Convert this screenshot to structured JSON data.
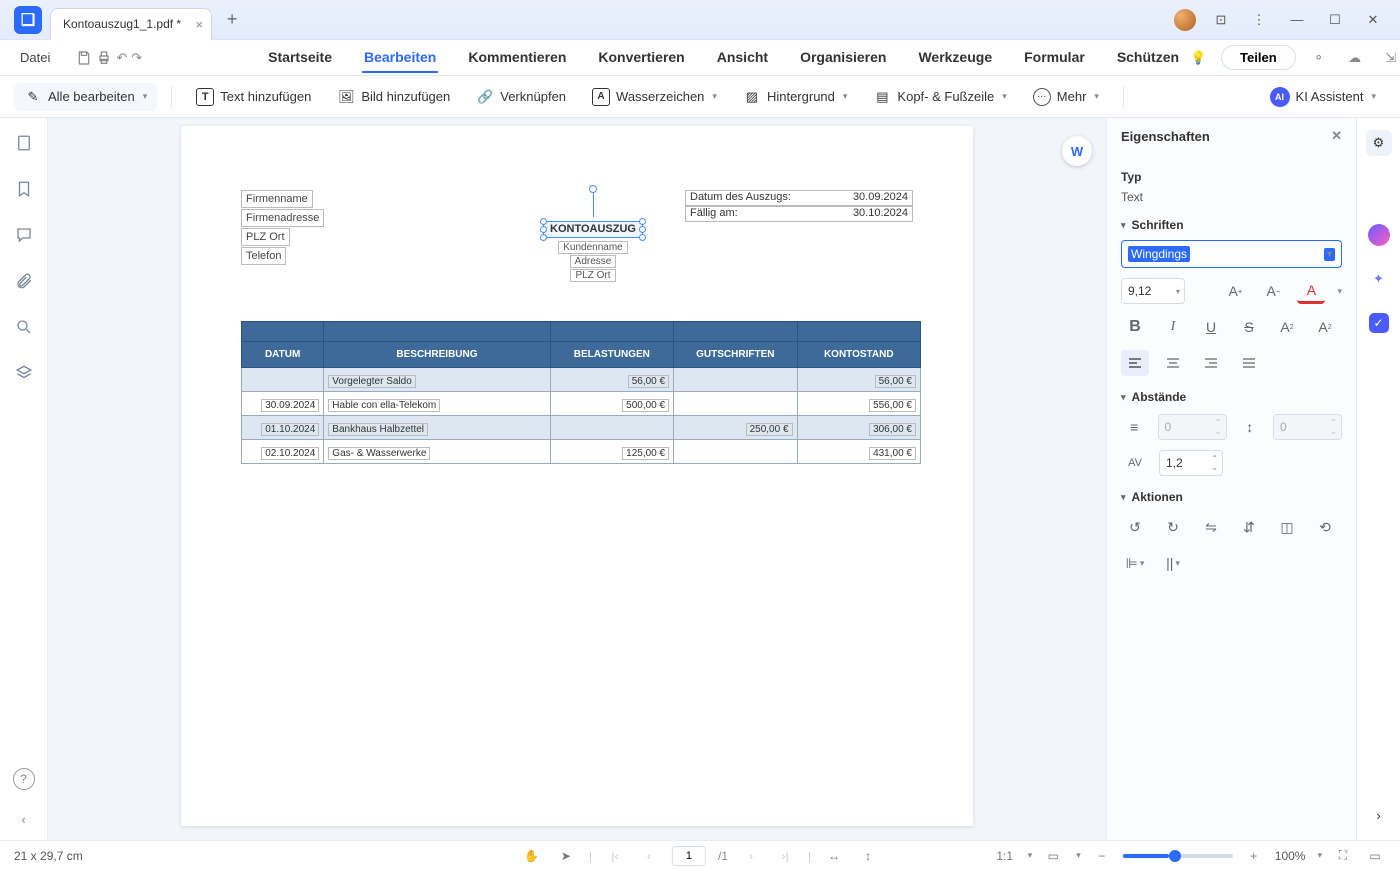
{
  "tab_title": "Kontoauszug1_1.pdf *",
  "menu": {
    "file": "Datei",
    "tabs": [
      "Startseite",
      "Bearbeiten",
      "Kommentieren",
      "Konvertieren",
      "Ansicht",
      "Organisieren",
      "Werkzeuge",
      "Formular",
      "Schützen"
    ],
    "active": "Bearbeiten",
    "teilen": "Teilen"
  },
  "toolbar": {
    "edit_all": "Alle bearbeiten",
    "add_text": "Text hinzufügen",
    "add_image": "Bild hinzufügen",
    "link": "Verknüpfen",
    "watermark": "Wasserzeichen",
    "background": "Hintergrund",
    "header_footer": "Kopf- & Fußzeile",
    "more": "Mehr",
    "ai": "KI Assistent"
  },
  "doc": {
    "fields": [
      "Firmenname",
      "Firmenadresse",
      "PLZ Ort",
      "Telefon"
    ],
    "meta": [
      {
        "label": "Datum des Auszugs:",
        "value": "30.09.2024"
      },
      {
        "label": "Fällig am:",
        "value": "30.10.2024"
      }
    ],
    "title": "KONTOAUSZUG",
    "sub": [
      "Kundenname",
      "Adresse",
      "PLZ Ort"
    ],
    "headers": [
      "DATUM",
      "BESCHREIBUNG",
      "BELASTUNGEN",
      "GUTSCHRIFTEN",
      "KONTOSTAND"
    ],
    "rows": [
      {
        "date": "",
        "desc": "Vorgelegter Saldo",
        "deb": "56,00 €",
        "cred": "",
        "bal": "56,00 €",
        "alt": true
      },
      {
        "date": "30.09.2024",
        "desc": "Hable con ella-Telekom",
        "deb": "500,00 €",
        "cred": "",
        "bal": "556,00 €",
        "alt": false
      },
      {
        "date": "01.10.2024",
        "desc": "Bankhaus Halbzettel",
        "deb": "",
        "cred": "250,00 €",
        "bal": "306,00 €",
        "alt": true
      },
      {
        "date": "02.10.2024",
        "desc": "Gas- & Wasserwerke",
        "deb": "125,00 €",
        "cred": "",
        "bal": "431,00 €",
        "alt": false
      }
    ]
  },
  "props": {
    "title": "Eigenschaften",
    "type_label": "Typ",
    "type_value": "Text",
    "fonts_label": "Schriften",
    "font_name": "Wingdings",
    "font_size": "9,12",
    "spacing_label": "Abstände",
    "line_val": "0",
    "char_val": "1,2",
    "actions_label": "Aktionen"
  },
  "status": {
    "dims": "21 x 29,7 cm",
    "page": "1",
    "pages": "/1",
    "zoom": "100%"
  }
}
